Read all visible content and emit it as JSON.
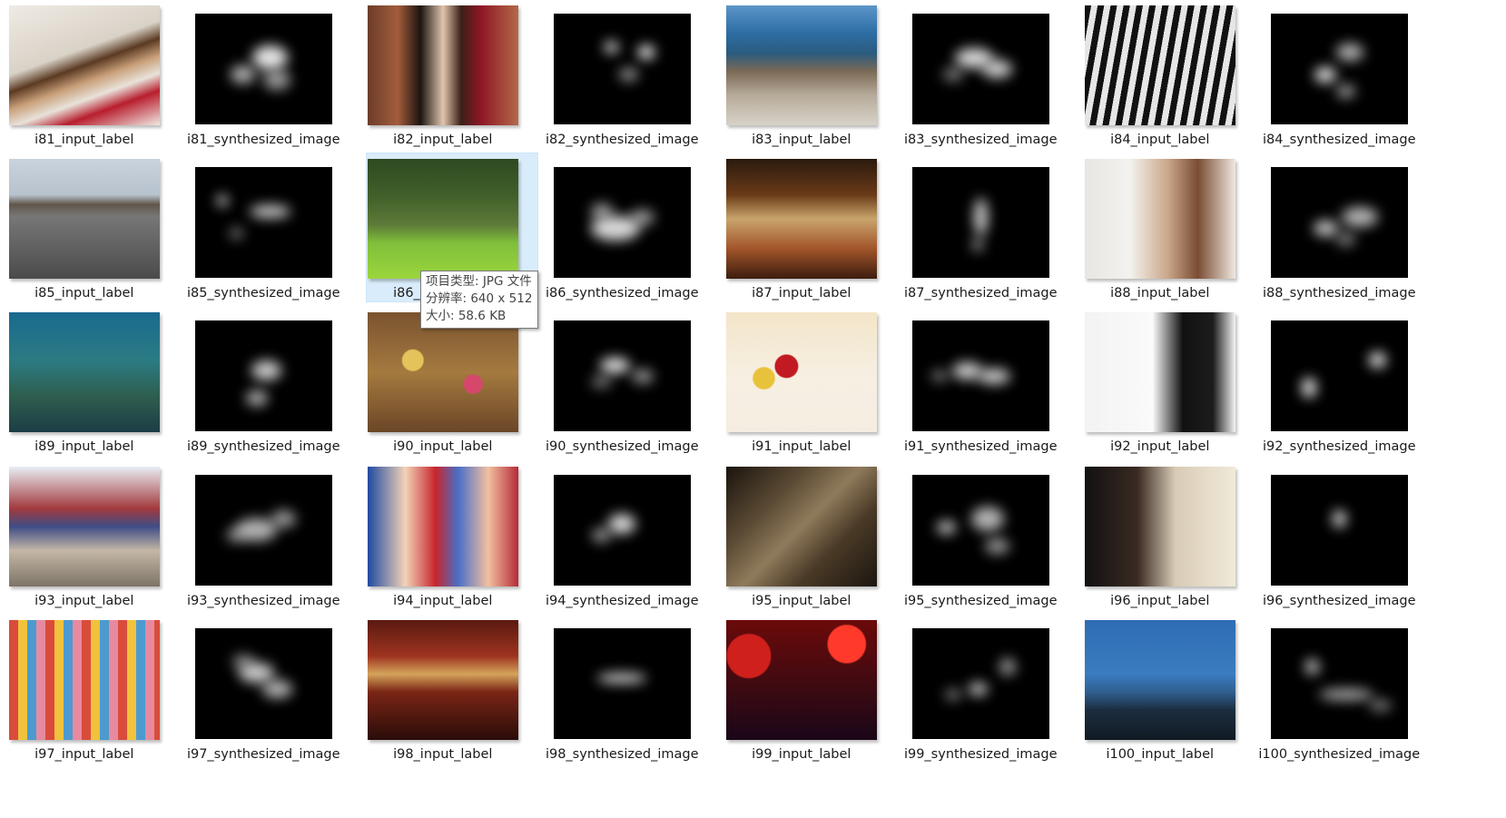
{
  "items": [
    {
      "label": "i81_input_label",
      "kind": "photo",
      "bg": "linear-gradient(160deg,#efeae4 0%,#d9d2c7 40%,#5b3a22 50%,#c9a07a 60%,#e8e2da 70%,#b81e2e 80%,#efe9e2 100%)"
    },
    {
      "label": "i81_synthesized_image",
      "kind": "map"
    },
    {
      "label": "i82_input_label",
      "kind": "photo",
      "bg": "linear-gradient(90deg,#6b3d2a 0%,#a35c3b 20%,#1b1410 35%,#e0c5ad 50%,#3b2017 62%,#8e1625 75%,#b4694a 100%)"
    },
    {
      "label": "i82_synthesized_image",
      "kind": "map"
    },
    {
      "label": "i83_input_label",
      "kind": "photo",
      "bg": "linear-gradient(180deg,#5d95c9 0%,#2e6fa6 22%,#2a5b7f 40%,#7b6a55 55%,#b6ab9a 75%,#d7d2c8 100%)"
    },
    {
      "label": "i83_synthesized_image",
      "kind": "map"
    },
    {
      "label": "i84_input_label",
      "kind": "photo",
      "bg": "repeating-linear-gradient(100deg,#111 0px,#111 7px,#e6e6e6 7px,#e6e6e6 14px)"
    },
    {
      "label": "i84_synthesized_image",
      "kind": "map"
    },
    {
      "label": "i85_input_label",
      "kind": "photo",
      "bg": "linear-gradient(180deg,#c9d3de 0%,#b7c2cd 30%,#61564a 38%,#777 48%,#4b4b4b 100%)"
    },
    {
      "label": "i85_synthesized_image",
      "kind": "map"
    },
    {
      "label": "i86_input_label",
      "kind": "photo",
      "bg": "linear-gradient(180deg,#2e4a22 0%,#3f5f2a 30%,#5e7a39 55%,#7fbf3b 70%,#9bd63c 100%)"
    },
    {
      "label": "i86_synthesized_image",
      "kind": "map"
    },
    {
      "label": "i87_input_label",
      "kind": "photo",
      "bg": "linear-gradient(180deg,#2a1a0e 0%,#6a3a17 30%,#c9a46c 50%,#a2552a 75%,#3c1d0e 100%)"
    },
    {
      "label": "i87_synthesized_image",
      "kind": "map"
    },
    {
      "label": "i88_input_label",
      "kind": "photo",
      "bg": "linear-gradient(90deg,#e8e6e2 0%,#f4f2ee 30%,#caa78a 55%,#7a4c33 75%,#efe8e0 100%)"
    },
    {
      "label": "i88_synthesized_image",
      "kind": "map"
    },
    {
      "label": "i89_input_label",
      "kind": "photo",
      "bg": "linear-gradient(180deg,#1a6a8f 0%,#2b7b83 40%,#2e5e4e 70%,#1c3d45 100%)"
    },
    {
      "label": "i89_synthesized_image",
      "kind": "map"
    },
    {
      "label": "i90_input_label",
      "kind": "photo",
      "bg": "radial-gradient(circle at 30% 40%,#e3c35a 0 8%,transparent 9%),radial-gradient(circle at 70% 60%,#d6486b 0 7%,transparent 8%),linear-gradient(180deg,#7a5330 0%,#a47a3f 50%,#6b4627 100%)"
    },
    {
      "label": "i90_synthesized_image",
      "kind": "map"
    },
    {
      "label": "i91_input_label",
      "kind": "photo",
      "bg": "radial-gradient(circle at 40% 45%,#c21a22 0 10%,transparent 11%),radial-gradient(circle at 25% 55%,#e8c23b 0 8%,transparent 9%),linear-gradient(180deg,#f3e5c9 0%,#f6efe2 55%,#f5ede1 100%)"
    },
    {
      "label": "i91_synthesized_image",
      "kind": "map"
    },
    {
      "label": "i92_input_label",
      "kind": "photo",
      "bg": "linear-gradient(90deg,#f3f3f3 0%,#fafafa 45%,#111 65%,#1c1c1c 85%,#f5f5f5 100%)"
    },
    {
      "label": "i92_synthesized_image",
      "kind": "map"
    },
    {
      "label": "i93_input_label",
      "kind": "photo",
      "bg": "linear-gradient(180deg,#e9eef4 0%,#a23a3e 35%,#3f4d86 50%,#c4b7a6 70%,#7d7466 100%)"
    },
    {
      "label": "i93_synthesized_image",
      "kind": "map"
    },
    {
      "label": "i94_input_label",
      "kind": "photo",
      "bg": "linear-gradient(90deg,#1f4aa0 0%,#f2d3b8 25%,#c7262c 45%,#4a6ec8 60%,#f2c0a0 80%,#b52a38 100%)"
    },
    {
      "label": "i94_synthesized_image",
      "kind": "map"
    },
    {
      "label": "i95_input_label",
      "kind": "photo",
      "bg": "linear-gradient(135deg,#1a140d 0%,#5b4a34 30%,#8f7a5b 50%,#4a3a27 70%,#1c1610 100%)"
    },
    {
      "label": "i95_synthesized_image",
      "kind": "map"
    },
    {
      "label": "i96_input_label",
      "kind": "photo",
      "bg": "linear-gradient(90deg,#111 0%,#3a2a22 35%,#d8cbb6 60%,#f0ead9 100%)"
    },
    {
      "label": "i96_synthesized_image",
      "kind": "map"
    },
    {
      "label": "i97_input_label",
      "kind": "photo",
      "bg": "repeating-linear-gradient(90deg,#d94c3b 0 10px,#f1c23b 10px 20px,#4c9ad0 20px 30px,#e78aa0 30px 40px),linear-gradient(180deg,#bfc7cf,#6d6d6d)"
    },
    {
      "label": "i97_synthesized_image",
      "kind": "map"
    },
    {
      "label": "i98_input_label",
      "kind": "photo",
      "bg": "linear-gradient(180deg,#5a1a10 0%,#9e3320 30%,#d4a35a 45%,#7a2515 60%,#2a0c08 100%)"
    },
    {
      "label": "i98_synthesized_image",
      "kind": "map"
    },
    {
      "label": "i99_input_label",
      "kind": "photo",
      "bg": "radial-gradient(circle at 80% 20%,#ff3a2a 0 12%,transparent 13%),radial-gradient(circle at 15% 30%,#d0201c 0 14%,transparent 15%),linear-gradient(180deg,#6b0a0a 0%,#3a0a12 60%,#1a0618 100%)"
    },
    {
      "label": "i99_synthesized_image",
      "kind": "map"
    },
    {
      "label": "i100_input_label",
      "kind": "photo",
      "bg": "linear-gradient(180deg,#2e6cb3 0%,#3a7cc0 45%,#2f5f8f 60%,#1c2d3f 75%,#101a24 100%)"
    },
    {
      "label": "i100_synthesized_image",
      "kind": "map"
    }
  ],
  "tooltip": {
    "type_line": "项目类型: JPG 文件",
    "resolution_line": "分辨率: 640 x 512",
    "size_line": "大小: 58.6 KB"
  },
  "selected_index": 10
}
